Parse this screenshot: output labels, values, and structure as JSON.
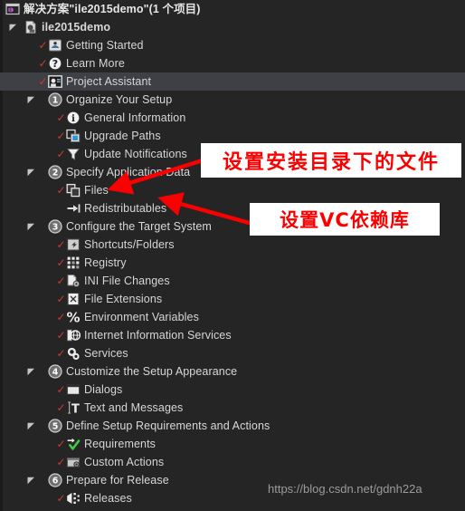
{
  "window": {
    "background_color": "#252526",
    "selection_color": "#3f3f46",
    "check_color": "#d03a2a",
    "annotation_color": "#fa0000",
    "watermark": "https://blog.csdn.net/gdnh22a"
  },
  "tree": {
    "items": [
      {
        "label": "解决方案\"ile2015demo\"(1 个项目)",
        "level": 0,
        "icon": "solution-icon",
        "checked": false,
        "expander": "none",
        "selected": false
      },
      {
        "label": "ile2015demo",
        "level": 1,
        "icon": "project-icon",
        "checked": false,
        "expander": "expanded",
        "selected": false
      },
      {
        "label": "Getting Started",
        "level": 2,
        "icon": "getting-started-icon",
        "checked": true,
        "expander": "none",
        "selected": false
      },
      {
        "label": "Learn More",
        "level": 2,
        "icon": "question-icon",
        "checked": true,
        "expander": "none",
        "selected": false
      },
      {
        "label": "Project Assistant",
        "level": 2,
        "icon": "project-assistant-icon",
        "checked": true,
        "expander": "none",
        "selected": true
      },
      {
        "label": "Organize Your Setup",
        "level": 2,
        "icon": "step-1-icon",
        "checked": false,
        "expander": "expanded",
        "selected": false
      },
      {
        "label": "General Information",
        "level": 3,
        "icon": "info-icon",
        "checked": true,
        "expander": "none",
        "selected": false
      },
      {
        "label": "Upgrade Paths",
        "level": 3,
        "icon": "upgrade-paths-icon",
        "checked": true,
        "expander": "none",
        "selected": false
      },
      {
        "label": "Update Notifications",
        "level": 3,
        "icon": "update-notifications-icon",
        "checked": true,
        "expander": "none",
        "selected": false
      },
      {
        "label": "Specify Application Data",
        "level": 2,
        "icon": "step-2-icon",
        "checked": false,
        "expander": "expanded",
        "selected": false
      },
      {
        "label": "Files",
        "level": 3,
        "icon": "files-icon",
        "checked": true,
        "expander": "none",
        "selected": false
      },
      {
        "label": "Redistributables",
        "level": 3,
        "icon": "redistributables-icon",
        "checked": false,
        "expander": "none",
        "selected": false
      },
      {
        "label": "Configure the Target System",
        "level": 2,
        "icon": "step-3-icon",
        "checked": false,
        "expander": "expanded",
        "selected": false
      },
      {
        "label": "Shortcuts/Folders",
        "level": 3,
        "icon": "shortcuts-folders-icon",
        "checked": true,
        "expander": "none",
        "selected": false
      },
      {
        "label": "Registry",
        "level": 3,
        "icon": "registry-icon",
        "checked": true,
        "expander": "none",
        "selected": false
      },
      {
        "label": "INI File Changes",
        "level": 3,
        "icon": "ini-file-icon",
        "checked": true,
        "expander": "none",
        "selected": false
      },
      {
        "label": "File Extensions",
        "level": 3,
        "icon": "file-extensions-icon",
        "checked": true,
        "expander": "none",
        "selected": false
      },
      {
        "label": "Environment Variables",
        "level": 3,
        "icon": "environment-variables-icon",
        "checked": true,
        "expander": "none",
        "selected": false
      },
      {
        "label": "Internet Information Services",
        "level": 3,
        "icon": "iis-icon",
        "checked": true,
        "expander": "none",
        "selected": false
      },
      {
        "label": "Services",
        "level": 3,
        "icon": "services-icon",
        "checked": true,
        "expander": "none",
        "selected": false
      },
      {
        "label": "Customize the Setup Appearance",
        "level": 2,
        "icon": "step-4-icon",
        "checked": false,
        "expander": "expanded",
        "selected": false
      },
      {
        "label": "Dialogs",
        "level": 3,
        "icon": "dialogs-icon",
        "checked": true,
        "expander": "none",
        "selected": false
      },
      {
        "label": "Text and Messages",
        "level": 3,
        "icon": "text-messages-icon",
        "checked": true,
        "expander": "none",
        "selected": false
      },
      {
        "label": "Define Setup Requirements and Actions",
        "level": 2,
        "icon": "step-5-icon",
        "checked": false,
        "expander": "expanded",
        "selected": false
      },
      {
        "label": "Requirements",
        "level": 3,
        "icon": "requirements-icon",
        "checked": true,
        "expander": "none",
        "selected": false
      },
      {
        "label": "Custom Actions",
        "level": 3,
        "icon": "custom-actions-icon",
        "checked": true,
        "expander": "none",
        "selected": false
      },
      {
        "label": "Prepare for Release",
        "level": 2,
        "icon": "step-6-icon",
        "checked": false,
        "expander": "expanded",
        "selected": false
      },
      {
        "label": "Releases",
        "level": 3,
        "icon": "releases-icon",
        "checked": true,
        "expander": "none",
        "selected": false
      }
    ]
  },
  "annotations": [
    {
      "text": "设置安装目录下的文件",
      "target": "Files"
    },
    {
      "text": "设置VC依赖库",
      "target": "Redistributables"
    }
  ]
}
